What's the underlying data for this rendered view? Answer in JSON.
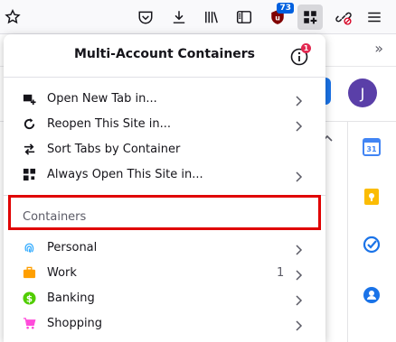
{
  "toolbar": {
    "extension_badge": "73",
    "icons": [
      "bookmark-star-icon",
      "pocket-icon",
      "download-icon",
      "library-icon",
      "sidebar-icon",
      "ublock-icon",
      "containers-icon",
      "no-link-icon",
      "hamburger-menu-icon"
    ]
  },
  "background": {
    "avatar_letter": "J",
    "overflow_chevron": "»",
    "collapse_chevron": "^"
  },
  "popup": {
    "title": "Multi-Account Containers",
    "info_badge": "1",
    "actions": [
      {
        "label": "Open New Tab in...",
        "icon": "new-tab-icon"
      },
      {
        "label": "Reopen This Site in...",
        "icon": "reopen-icon"
      },
      {
        "label": "Sort Tabs by Container",
        "icon": "sort-icon"
      },
      {
        "label": "Always Open This Site in...",
        "icon": "always-open-icon"
      }
    ],
    "containers_heading": "Containers",
    "containers": [
      {
        "label": "Personal",
        "icon": "fingerprint-icon",
        "color": "#37adff",
        "count": ""
      },
      {
        "label": "Work",
        "icon": "briefcase-icon",
        "color": "#ff9f00",
        "count": "1"
      },
      {
        "label": "Banking",
        "icon": "dollar-icon",
        "color": "#51cd00",
        "count": ""
      },
      {
        "label": "Shopping",
        "icon": "cart-icon",
        "color": "#ff4bda",
        "count": ""
      }
    ]
  },
  "colors": {
    "highlight": "#e00000",
    "avatar_bg": "#5a3fa8",
    "accent_blue": "#1a73e8"
  }
}
